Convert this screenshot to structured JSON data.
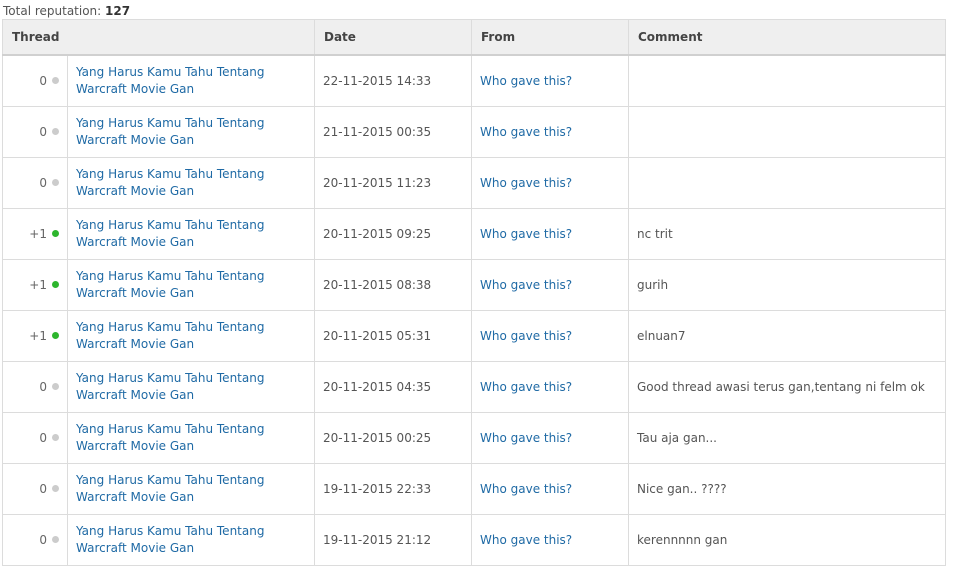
{
  "summary": {
    "label": "Total reputation:",
    "value": "127"
  },
  "columns": {
    "thread": "Thread",
    "date": "Date",
    "from": "From",
    "comment": "Comment"
  },
  "colors": {
    "positive": "#2db62d",
    "neutral": "#cccccc",
    "link": "#1f6aa5"
  },
  "rows": [
    {
      "points": "0",
      "status": "neutral",
      "thread": "Yang Harus Kamu Tahu Tentang Warcraft Movie Gan",
      "date": "22-11-2015 14:33",
      "from": "Who gave this?",
      "comment": ""
    },
    {
      "points": "0",
      "status": "neutral",
      "thread": "Yang Harus Kamu Tahu Tentang Warcraft Movie Gan",
      "date": "21-11-2015 00:35",
      "from": "Who gave this?",
      "comment": ""
    },
    {
      "points": "0",
      "status": "neutral",
      "thread": "Yang Harus Kamu Tahu Tentang Warcraft Movie Gan",
      "date": "20-11-2015 11:23",
      "from": "Who gave this?",
      "comment": ""
    },
    {
      "points": "+1",
      "status": "positive",
      "thread": "Yang Harus Kamu Tahu Tentang Warcraft Movie Gan",
      "date": "20-11-2015 09:25",
      "from": "Who gave this?",
      "comment": "nc trit"
    },
    {
      "points": "+1",
      "status": "positive",
      "thread": "Yang Harus Kamu Tahu Tentang Warcraft Movie Gan",
      "date": "20-11-2015 08:38",
      "from": "Who gave this?",
      "comment": "gurih"
    },
    {
      "points": "+1",
      "status": "positive",
      "thread": "Yang Harus Kamu Tahu Tentang Warcraft Movie Gan",
      "date": "20-11-2015 05:31",
      "from": "Who gave this?",
      "comment": "elnuan7"
    },
    {
      "points": "0",
      "status": "neutral",
      "thread": "Yang Harus Kamu Tahu Tentang Warcraft Movie Gan",
      "date": "20-11-2015 04:35",
      "from": "Who gave this?",
      "comment": "Good thread awasi terus gan,tentang ni felm ok"
    },
    {
      "points": "0",
      "status": "neutral",
      "thread": "Yang Harus Kamu Tahu Tentang Warcraft Movie Gan",
      "date": "20-11-2015 00:25",
      "from": "Who gave this?",
      "comment": "Tau aja gan..."
    },
    {
      "points": "0",
      "status": "neutral",
      "thread": "Yang Harus Kamu Tahu Tentang Warcraft Movie Gan",
      "date": "19-11-2015 22:33",
      "from": "Who gave this?",
      "comment": "Nice gan.. ????"
    },
    {
      "points": "0",
      "status": "neutral",
      "thread": "Yang Harus Kamu Tahu Tentang Warcraft Movie Gan",
      "date": "19-11-2015 21:12",
      "from": "Who gave this?",
      "comment": "kerennnnn gan"
    }
  ]
}
